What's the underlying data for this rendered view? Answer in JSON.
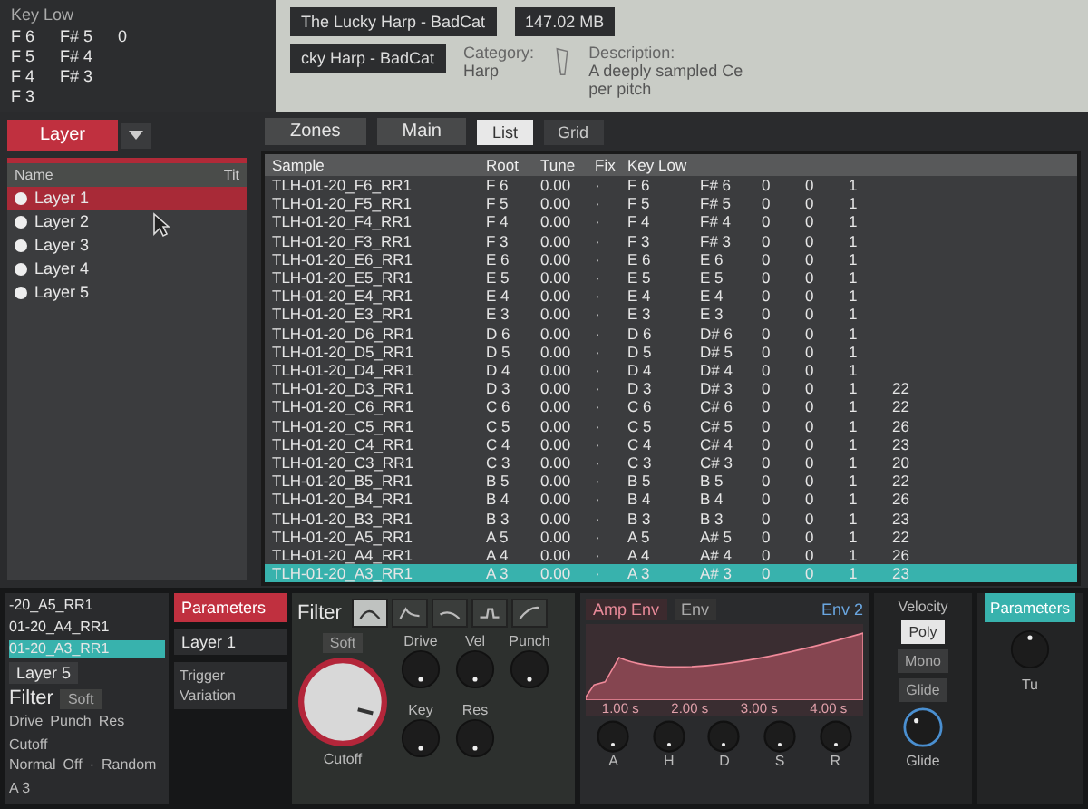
{
  "back_window": {
    "column": "Key Low",
    "values": [
      "F 6",
      "F 5",
      "F 4",
      "F 3"
    ],
    "values_2": [
      "F# 5",
      "F# 4",
      "F# 3"
    ],
    "value_3": "0"
  },
  "instrument": {
    "name": "The Lucky Harp - BadCat",
    "size": "147.02 MB",
    "category_label": "Category:",
    "category": "Harp",
    "description_label": "Description:",
    "description": "A deeply sampled Ce",
    "description_2": "per pitch",
    "name_copy": "cky Harp - BadCat"
  },
  "view_tabs": [
    {
      "label": "List",
      "selected": true
    },
    {
      "label": "Grid",
      "selected": false
    }
  ],
  "main_dropdown": "Main",
  "zones_dropdown": "Zones",
  "layer_panel": {
    "tab": "Layer",
    "name_column": "Name",
    "title_column": "Tit",
    "layers": [
      {
        "label": "Layer 1",
        "selected": true
      },
      {
        "label": "Layer 2",
        "selected": false
      },
      {
        "label": "Layer 3",
        "selected": false
      },
      {
        "label": "Layer 4",
        "selected": false
      },
      {
        "label": "Layer 5",
        "selected": false
      }
    ]
  },
  "table": {
    "columns": [
      "Sample",
      "Root",
      "Tune",
      "Fix",
      "Key Low"
    ],
    "rows": [
      {
        "sample": "TLH-01-20_F6_RR1",
        "root": "F 6",
        "tune": "0.00",
        "fix": "·",
        "key_low": "F 6",
        "column_6": "F# 6",
        "column_7": "0",
        "column_8": "0",
        "column_9": "1",
        "selected": false
      },
      {
        "sample": "TLH-01-20_F5_RR1",
        "root": "F 5",
        "tune": "0.00",
        "fix": "·",
        "key_low": "F 5",
        "column_6": "F# 5",
        "column_7": "0",
        "column_8": "0",
        "column_9": "1",
        "selected": false
      },
      {
        "sample": "TLH-01-20_F4_RR1",
        "root": "F 4",
        "tune": "0.00",
        "fix": "·",
        "key_low": "F 4",
        "column_6": "F# 4",
        "column_7": "0",
        "column_8": "0",
        "column_9": "1",
        "selected": false
      },
      {
        "sample": "TLH-01-20_F3_RR1",
        "root": "F 3",
        "tune": "0.00",
        "fix": "·",
        "key_low": "F 3",
        "column_6": "F# 3",
        "column_7": "0",
        "column_8": "0",
        "column_9": "1",
        "selected": false
      },
      {
        "sample": "TLH-01-20_E6_RR1",
        "root": "E 6",
        "tune": "0.00",
        "fix": "·",
        "key_low": "E 6",
        "column_6": "E 6",
        "column_7": "0",
        "column_8": "0",
        "column_9": "1",
        "selected": false
      },
      {
        "sample": "TLH-01-20_E5_RR1",
        "root": "E 5",
        "tune": "0.00",
        "fix": "·",
        "key_low": "E 5",
        "column_6": "E 5",
        "column_7": "0",
        "column_8": "0",
        "column_9": "1",
        "selected": false
      },
      {
        "sample": "TLH-01-20_E4_RR1",
        "root": "E 4",
        "tune": "0.00",
        "fix": "·",
        "key_low": "E 4",
        "column_6": "E 4",
        "column_7": "0",
        "column_8": "0",
        "column_9": "1",
        "selected": false
      },
      {
        "sample": "TLH-01-20_E3_RR1",
        "root": "E 3",
        "tune": "0.00",
        "fix": "·",
        "key_low": "E 3",
        "column_6": "E 3",
        "column_7": "0",
        "column_8": "0",
        "column_9": "1",
        "selected": false
      },
      {
        "sample": "TLH-01-20_D6_RR1",
        "root": "D 6",
        "tune": "0.00",
        "fix": "·",
        "key_low": "D 6",
        "column_6": "D# 6",
        "column_7": "0",
        "column_8": "0",
        "column_9": "1",
        "selected": false
      },
      {
        "sample": "TLH-01-20_D5_RR1",
        "root": "D 5",
        "tune": "0.00",
        "fix": "·",
        "key_low": "D 5",
        "column_6": "D# 5",
        "column_7": "0",
        "column_8": "0",
        "column_9": "1",
        "selected": false
      },
      {
        "sample": "TLH-01-20_D4_RR1",
        "root": "D 4",
        "tune": "0.00",
        "fix": "·",
        "key_low": "D 4",
        "column_6": "D# 4",
        "column_7": "0",
        "column_8": "0",
        "column_9": "1",
        "selected": false
      },
      {
        "sample": "TLH-01-20_D3_RR1",
        "root": "D 3",
        "tune": "0.00",
        "fix": "·",
        "key_low": "D 3",
        "column_6": "D# 3",
        "column_7": "0",
        "column_8": "0",
        "column_9": "1",
        "column_10": "22",
        "selected": false
      },
      {
        "sample": "TLH-01-20_C6_RR1",
        "root": "C 6",
        "tune": "0.00",
        "fix": "·",
        "key_low": "C 6",
        "column_6": "C# 6",
        "column_7": "0",
        "column_8": "0",
        "column_9": "1",
        "column_10": "22",
        "selected": false
      },
      {
        "sample": "TLH-01-20_C5_RR1",
        "root": "C 5",
        "tune": "0.00",
        "fix": "·",
        "key_low": "C 5",
        "column_6": "C# 5",
        "column_7": "0",
        "column_8": "0",
        "column_9": "1",
        "column_10": "26",
        "selected": false
      },
      {
        "sample": "TLH-01-20_C4_RR1",
        "root": "C 4",
        "tune": "0.00",
        "fix": "·",
        "key_low": "C 4",
        "column_6": "C# 4",
        "column_7": "0",
        "column_8": "0",
        "column_9": "1",
        "column_10": "23",
        "selected": false
      },
      {
        "sample": "TLH-01-20_C3_RR1",
        "root": "C 3",
        "tune": "0.00",
        "fix": "·",
        "key_low": "C 3",
        "column_6": "C# 3",
        "column_7": "0",
        "column_8": "0",
        "column_9": "1",
        "column_10": "20",
        "selected": false
      },
      {
        "sample": "TLH-01-20_B5_RR1",
        "root": "B 5",
        "tune": "0.00",
        "fix": "·",
        "key_low": "B 5",
        "column_6": "B 5",
        "column_7": "0",
        "column_8": "0",
        "column_9": "1",
        "column_10": "22",
        "selected": false
      },
      {
        "sample": "TLH-01-20_B4_RR1",
        "root": "B 4",
        "tune": "0.00",
        "fix": "·",
        "key_low": "B 4",
        "column_6": "B 4",
        "column_7": "0",
        "column_8": "0",
        "column_9": "1",
        "column_10": "26",
        "selected": false
      },
      {
        "sample": "TLH-01-20_B3_RR1",
        "root": "B 3",
        "tune": "0.00",
        "fix": "·",
        "key_low": "B 3",
        "column_6": "B 3",
        "column_7": "0",
        "column_8": "0",
        "column_9": "1",
        "column_10": "23",
        "selected": false
      },
      {
        "sample": "TLH-01-20_A5_RR1",
        "root": "A 5",
        "tune": "0.00",
        "fix": "·",
        "key_low": "A 5",
        "column_6": "A# 5",
        "column_7": "0",
        "column_8": "0",
        "column_9": "1",
        "column_10": "22",
        "selected": false
      },
      {
        "sample": "TLH-01-20_A4_RR1",
        "root": "A 4",
        "tune": "0.00",
        "fix": "·",
        "key_low": "A 4",
        "column_6": "A# 4",
        "column_7": "0",
        "column_8": "0",
        "column_9": "1",
        "column_10": "26",
        "selected": false
      },
      {
        "sample": "TLH-01-20_A3_RR1",
        "root": "A 3",
        "tune": "0.00",
        "fix": "·",
        "key_low": "A 3",
        "column_6": "A# 3",
        "column_7": "0",
        "column_8": "0",
        "column_9": "1",
        "column_10": "23",
        "selected": true
      }
    ]
  },
  "back_panel": {
    "zones": [
      {
        "label": "-20_A5_RR1",
        "selected": false
      },
      {
        "label": "01-20_A4_RR1",
        "selected": false
      },
      {
        "label": "01-20_A3_RR1",
        "selected": true
      }
    ],
    "layer": "Layer 5",
    "title": "Filter",
    "soft": "Soft",
    "knobs": [
      "Drive",
      "Punch",
      "Res",
      "Cutoff"
    ],
    "values": [
      "Normal",
      "Off",
      "·",
      "Random",
      "A 3"
    ]
  },
  "parameters_button": "Parameters",
  "layer_label": "Layer 1",
  "trigger_list": [
    "Trigger",
    "Variation"
  ],
  "filter": {
    "title": "Filter",
    "soft": "Soft",
    "modes": [
      {
        "selected": true
      },
      {
        "selected": false
      },
      {
        "selected": false
      },
      {
        "selected": false
      },
      {
        "selected": false
      }
    ],
    "knobs": [
      "Drive",
      "Vel",
      "Punch",
      "Key",
      "Res"
    ],
    "cutoff": "Cutoff"
  },
  "envelope": {
    "tabs": [
      {
        "label": "Amp Env",
        "selected": true
      },
      {
        "label": "Env",
        "selected": false
      }
    ],
    "times": [
      "1.00 s",
      "2.00 s",
      "3.00 s",
      "4.00 s"
    ],
    "knobs": [
      "A",
      "H",
      "D",
      "S",
      "R"
    ],
    "env2": "Env 2"
  },
  "voice": {
    "title": "Velocity",
    "modes": [
      {
        "label": "Poly",
        "selected": true
      },
      {
        "label": "Mono",
        "selected": false
      }
    ],
    "glide_button": "Glide",
    "glide_knob": "Glide",
    "parameters_button": "Parameters",
    "tune_label": "Tu"
  }
}
